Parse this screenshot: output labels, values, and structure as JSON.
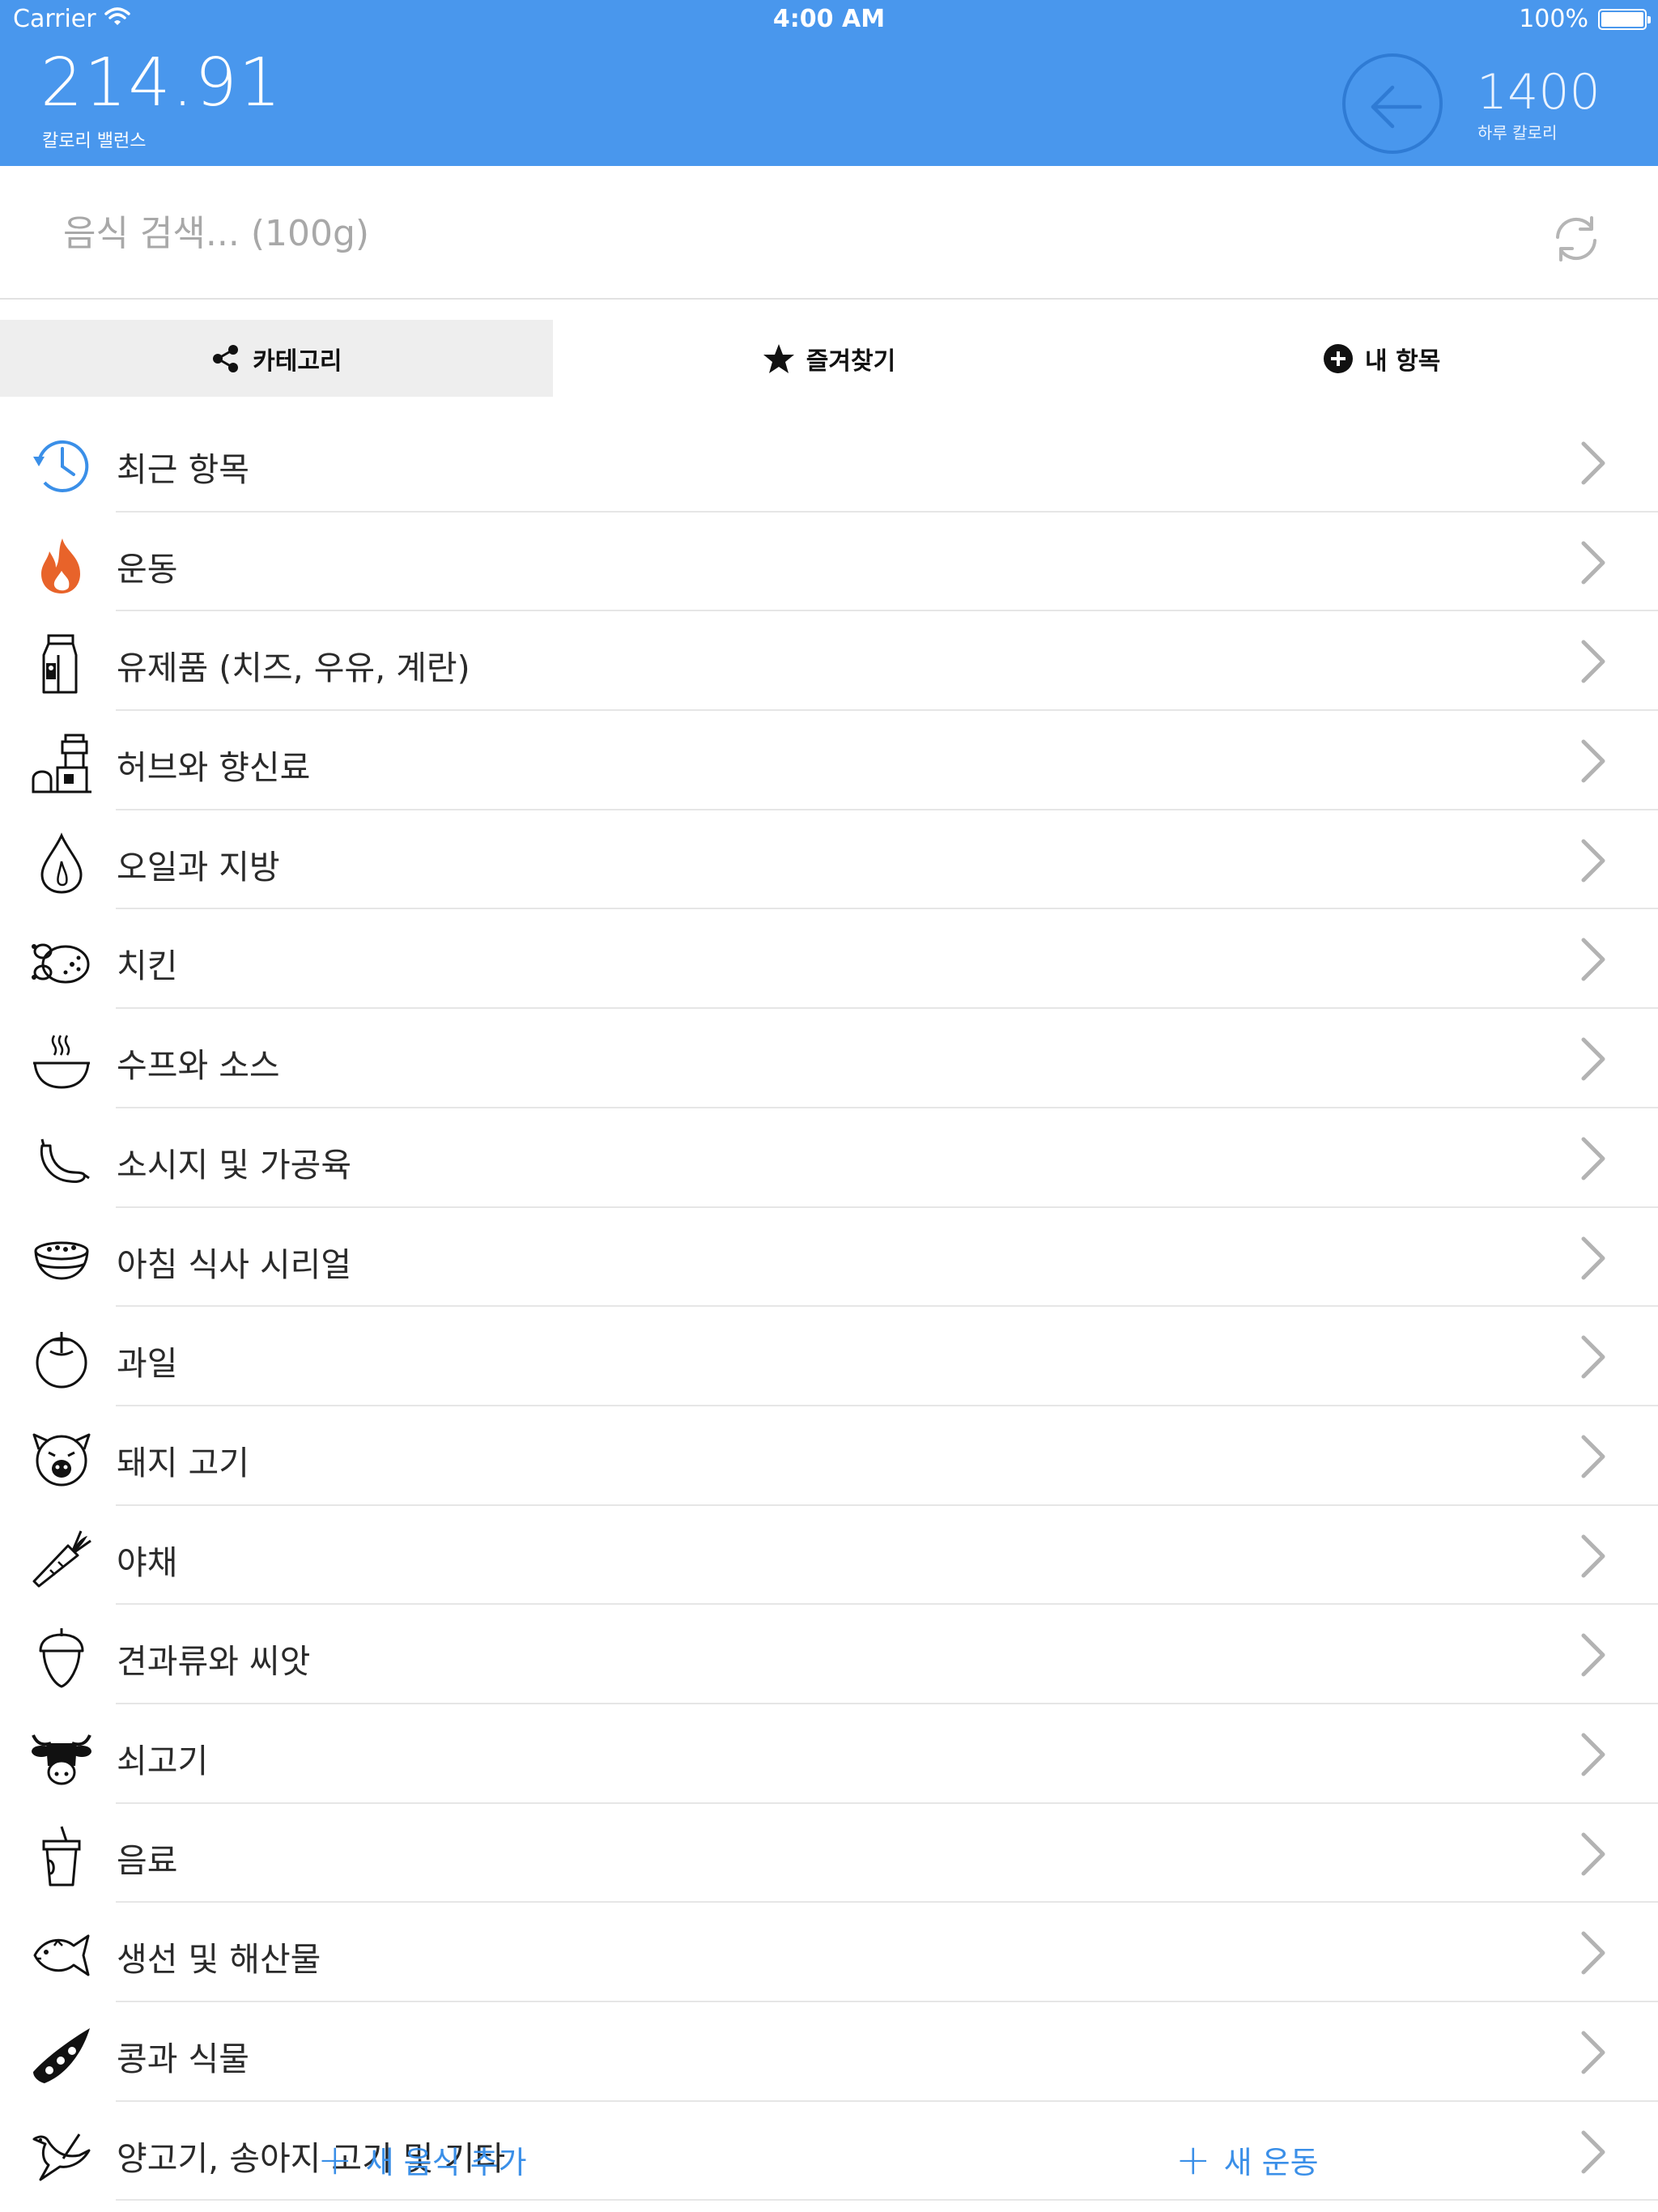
{
  "status_bar": {
    "carrier": "Carrier",
    "time": "4:00 AM",
    "battery": "100%"
  },
  "header": {
    "balance_value": "214.91",
    "balance_label": "칼로리 밸런스",
    "daily_value": "1400",
    "daily_label": "하루 칼로리",
    "back_icon": "arrow-left-circle-icon",
    "background_color": "#4997ed"
  },
  "search": {
    "placeholder": "음식 검색... (100g)",
    "value": "",
    "refresh_icon": "refresh-icon"
  },
  "tabs": [
    {
      "label": "카테고리",
      "icon": "share-icon",
      "active": true
    },
    {
      "label": "즐겨찾기",
      "icon": "star-icon",
      "active": false
    },
    {
      "label": "내 항목",
      "icon": "plus-circle-icon",
      "active": false
    }
  ],
  "categories": [
    {
      "label": "최근 항목",
      "icon": "clock-history-icon"
    },
    {
      "label": "운동",
      "icon": "flame-icon"
    },
    {
      "label": "유제품 (치즈, 우유, 계란)",
      "icon": "milk-carton-icon"
    },
    {
      "label": "허브와 향신료",
      "icon": "spice-grinder-icon"
    },
    {
      "label": "오일과 지방",
      "icon": "oil-drop-icon"
    },
    {
      "label": "치킨",
      "icon": "roast-chicken-icon"
    },
    {
      "label": "수프와 소스",
      "icon": "soup-bowl-icon"
    },
    {
      "label": "소시지 및 가공육",
      "icon": "sausage-icon"
    },
    {
      "label": "아침 식사 시리얼",
      "icon": "cereal-bowl-icon"
    },
    {
      "label": "과일",
      "icon": "fruit-icon"
    },
    {
      "label": "돼지 고기",
      "icon": "pig-icon"
    },
    {
      "label": "야채",
      "icon": "carrot-icon"
    },
    {
      "label": "견과류와 씨앗",
      "icon": "acorn-icon"
    },
    {
      "label": "쇠고기",
      "icon": "cow-icon"
    },
    {
      "label": "음료",
      "icon": "drink-cup-icon"
    },
    {
      "label": "생선 및 해산물",
      "icon": "fish-icon"
    },
    {
      "label": "콩과 식물",
      "icon": "pea-pod-icon"
    },
    {
      "label": "양고기, 송아지 고기 및 기타",
      "icon": "bird-icon"
    }
  ],
  "bottom_actions": {
    "add_food": "새 음식 추가",
    "add_exercise": "새 운동",
    "plus_symbol": "+"
  },
  "colors": {
    "accent": "#4997ed",
    "link": "#3a8fe8",
    "flame": "#e8632a",
    "recent_icon": "#3a8fe8"
  }
}
